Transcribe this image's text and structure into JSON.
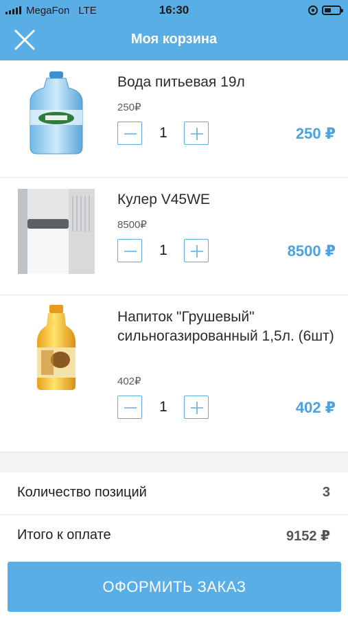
{
  "status_bar": {
    "carrier": "MegaFon",
    "network": "LTE",
    "time": "16:30",
    "battery_percent": 45
  },
  "nav": {
    "title": "Моя корзина",
    "close_icon": "close-icon"
  },
  "items": [
    {
      "name": "Вода питьевая 19л",
      "unit_price": "250₽",
      "qty": "1",
      "total": "250 ₽",
      "image": "water-bottle-image"
    },
    {
      "name": "Кулер V45WE",
      "unit_price": "8500₽",
      "qty": "1",
      "total": "8500 ₽",
      "image": "water-cooler-image"
    },
    {
      "name": "Напиток \"Грушевый\" сильногазированный 1,5л. (6шт)",
      "unit_price": "402₽",
      "qty": "1",
      "total": "402 ₽",
      "image": "pear-soda-image"
    }
  ],
  "summary": {
    "count_label": "Количество позиций",
    "count_value": "3",
    "total_label": "Итого к оплате",
    "total_value": "9152 ₽"
  },
  "checkout": {
    "label": "ОФОРМИТЬ ЗАКАЗ"
  },
  "colors": {
    "accent": "#5aaee6",
    "price": "#4aa3df"
  }
}
